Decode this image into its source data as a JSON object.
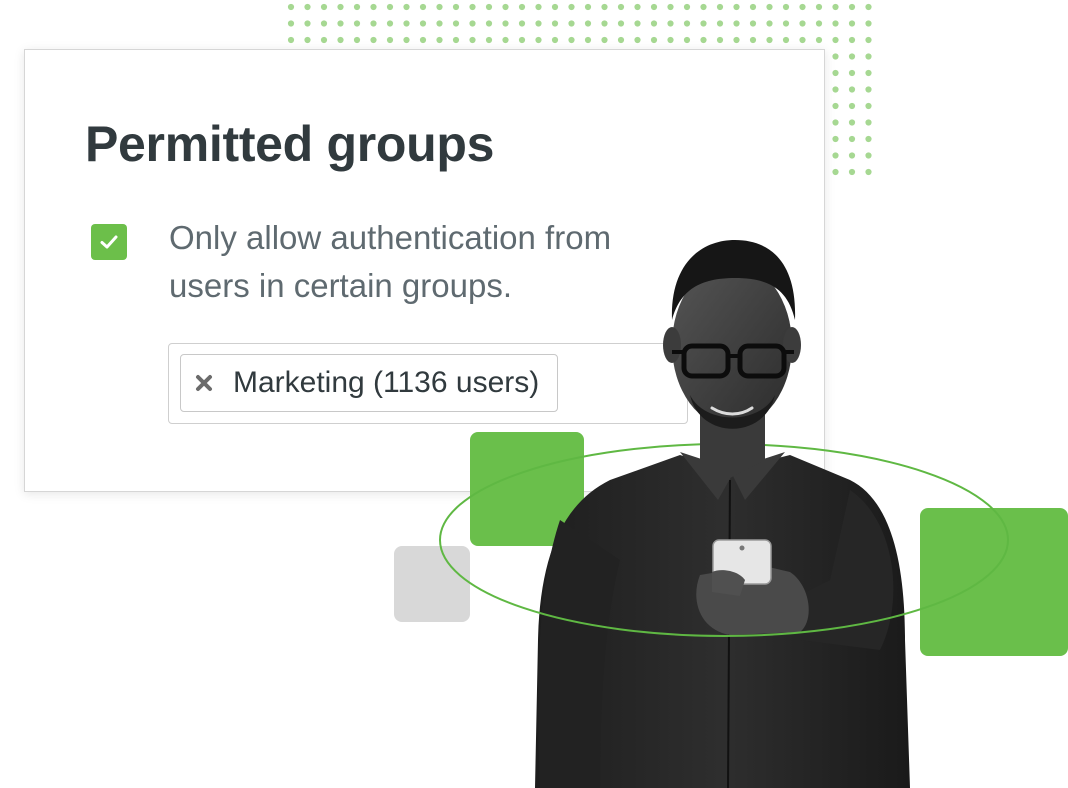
{
  "card": {
    "title": "Permitted groups",
    "option": {
      "label": "Only allow authentication from users in certain groups.",
      "checked": true
    },
    "selected_groups": [
      {
        "label": "Marketing (1136 users)"
      }
    ]
  },
  "icons": {
    "checkbox": "checkmark-icon",
    "tag_remove": "close-icon"
  },
  "colors": {
    "accent_green": "#6abf4b",
    "title_text": "#313a3e",
    "body_text": "#5f6a70",
    "decor_gray": "#d8d8d8",
    "dot_pattern": "#a6d892"
  }
}
